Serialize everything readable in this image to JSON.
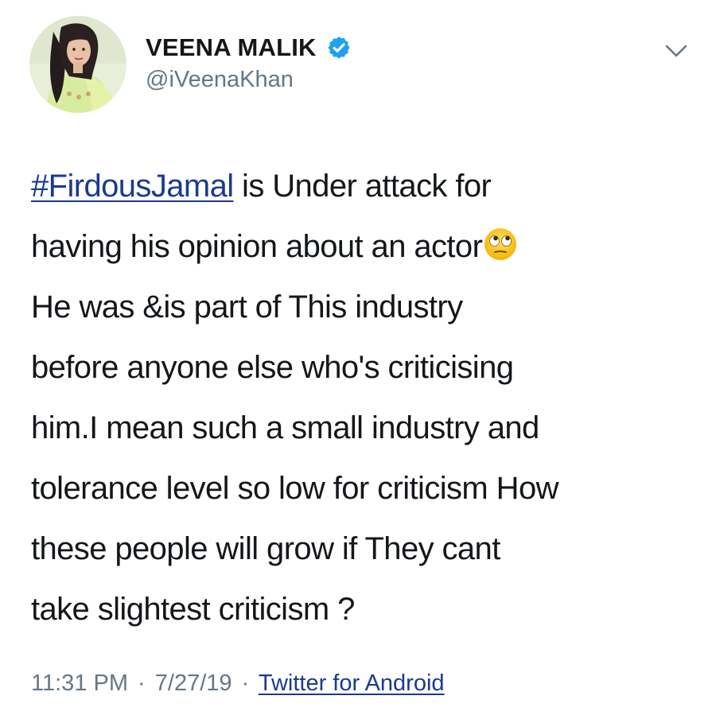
{
  "author": {
    "display_name": "VEENA MALIK",
    "handle": "@iVeenaKhan",
    "verified": true,
    "avatar_icon": "profile-photo"
  },
  "tweet": {
    "hashtag": "#FirdousJamal",
    "lines": [
      " is Under attack for",
      "having his opinion about an actor",
      "He was &is part of This industry",
      "before anyone else who's criticising",
      "him.I mean such a small industry and",
      "tolerance level so low for criticism How",
      "these people will grow if They cant",
      "take slightest criticism ?"
    ],
    "emoji": "face-with-rolling-eyes"
  },
  "meta": {
    "time": "11:31 PM",
    "separator": "·",
    "date": "7/27/19",
    "source": "Twitter for Android"
  },
  "colors": {
    "verified_badge": "#1da1f2",
    "link": "#1b3a8f",
    "secondary_text": "#657786"
  }
}
